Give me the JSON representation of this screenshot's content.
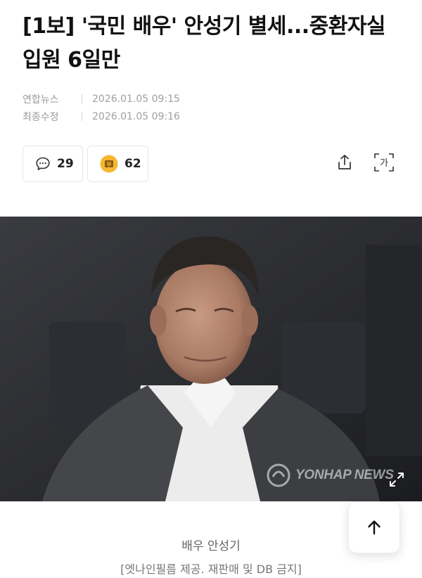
{
  "article": {
    "headline": "[1보] '국민 배우' 안성기 별세...중환자실 입원 6일만",
    "source_label": "연합뉴스",
    "published": "2026.01.05 09:15",
    "modified_label": "최종수정",
    "modified": "2026.01.05 09:16"
  },
  "actions": {
    "comment_count": "29",
    "reaction_count": "62",
    "reaction_icon_glyph": "부",
    "share_icon": "share-icon",
    "font_size_icon_glyph": "가"
  },
  "photo": {
    "watermark": "YONHAP NEWS",
    "caption": "배우 안성기",
    "credit": "[엣나인필름 제공. 재판매 및 DB 금지]"
  },
  "colors": {
    "reaction_badge": "#f5b731",
    "meta_text": "#9a9a9a",
    "caption_text": "#666666"
  }
}
